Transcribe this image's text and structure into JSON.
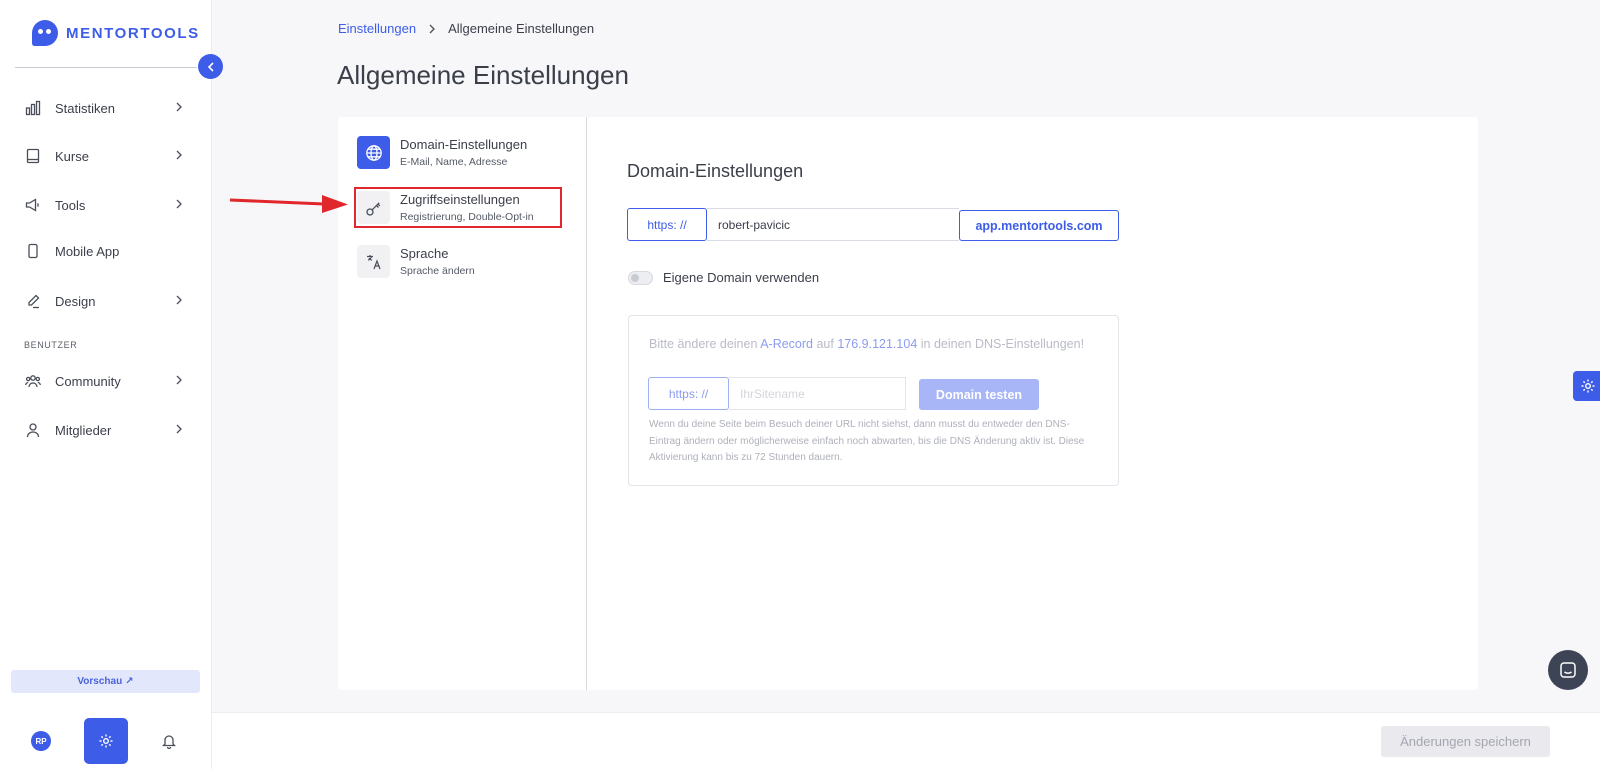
{
  "brand": {
    "name": "MENTORTOOLS"
  },
  "sidebar": {
    "items": [
      {
        "label": "Statistiken",
        "icon": "bar-chart-icon"
      },
      {
        "label": "Kurse",
        "icon": "book-icon"
      },
      {
        "label": "Tools",
        "icon": "megaphone-icon"
      },
      {
        "label": "Mobile App",
        "icon": "smartphone-icon"
      },
      {
        "label": "Design",
        "icon": "pencil-icon"
      },
      {
        "label": "Community",
        "icon": "users-icon"
      },
      {
        "label": "Mitglieder",
        "icon": "user-icon"
      }
    ],
    "section_label": "BENUTZER",
    "preview_label": "Vorschau",
    "avatar_initials": "RP"
  },
  "breadcrumb": {
    "parent": "Einstellungen",
    "current": "Allgemeine Einstellungen"
  },
  "page": {
    "title": "Allgemeine Einstellungen"
  },
  "settings_tabs": [
    {
      "label": "Domain-Einstellungen",
      "sub": "E-Mail, Name, Adresse",
      "icon": "globe-icon",
      "active": true
    },
    {
      "label": "Zugriffseinstellungen",
      "sub": "Registrierung, Double-Opt-in",
      "icon": "key-icon",
      "active": false
    },
    {
      "label": "Sprache",
      "sub": "Sprache ändern",
      "icon": "translate-icon",
      "active": false
    }
  ],
  "domain": {
    "title": "Domain-Einstellungen",
    "prefix": "https: //",
    "subdomain": "robert-pavicic",
    "suffix": "app.mentortools.com",
    "toggle_label": "Eigene Domain verwenden",
    "toggle_on": false
  },
  "dns": {
    "text_before": "Bitte ändere deinen ",
    "record": "A-Record",
    "text_mid": " auf ",
    "ip": "176.9.121.104",
    "text_after": " in deinen DNS-Einstellungen!",
    "prefix": "https: //",
    "placeholder": "IhrSitename",
    "test_button": "Domain testen",
    "note": "Wenn du deine Seite beim Besuch deiner URL nicht siehst, dann musst du entweder den DNS-Eintrag ändern oder möglicherweise einfach noch abwarten, bis die DNS Änderung aktiv ist. Diese Aktivierung kann bis zu 72 Stunden dauern."
  },
  "footer": {
    "save_label": "Änderungen speichern"
  },
  "colors": {
    "accent": "#3d5ce8",
    "highlight": "#e0272c"
  }
}
